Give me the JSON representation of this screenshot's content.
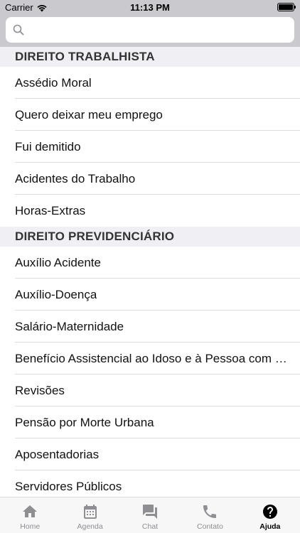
{
  "status_bar": {
    "carrier": "Carrier",
    "time": "11:13 PM"
  },
  "search": {
    "placeholder": ""
  },
  "sections": [
    {
      "title": "DIREITO TRABALHISTA",
      "items": [
        "Assédio Moral",
        "Quero deixar meu emprego",
        "Fui demitido",
        "Acidentes do Trabalho",
        "Horas-Extras"
      ]
    },
    {
      "title": "DIREITO PREVIDENCIÁRIO",
      "items": [
        "Auxílio Acidente",
        "Auxílio-Doença",
        "Salário-Maternidade",
        "Benefício Assistencial ao Idoso e à Pessoa com Deficiência",
        "Revisões",
        "Pensão por Morte Urbana",
        "Aposentadorias",
        "Servidores Públicos"
      ]
    }
  ],
  "tabs": [
    {
      "label": "Home",
      "icon": "home-icon",
      "active": false
    },
    {
      "label": "Agenda",
      "icon": "calendar-icon",
      "active": false
    },
    {
      "label": "Chat",
      "icon": "chat-icon",
      "active": false
    },
    {
      "label": "Contato",
      "icon": "phone-icon",
      "active": false
    },
    {
      "label": "Ajuda",
      "icon": "help-icon",
      "active": true
    }
  ],
  "colors": {
    "inactive_tab": "#8e8e93",
    "active_tab": "#000000",
    "section_bg": "#efeff4",
    "search_bar_bg": "#c9c9ce"
  }
}
